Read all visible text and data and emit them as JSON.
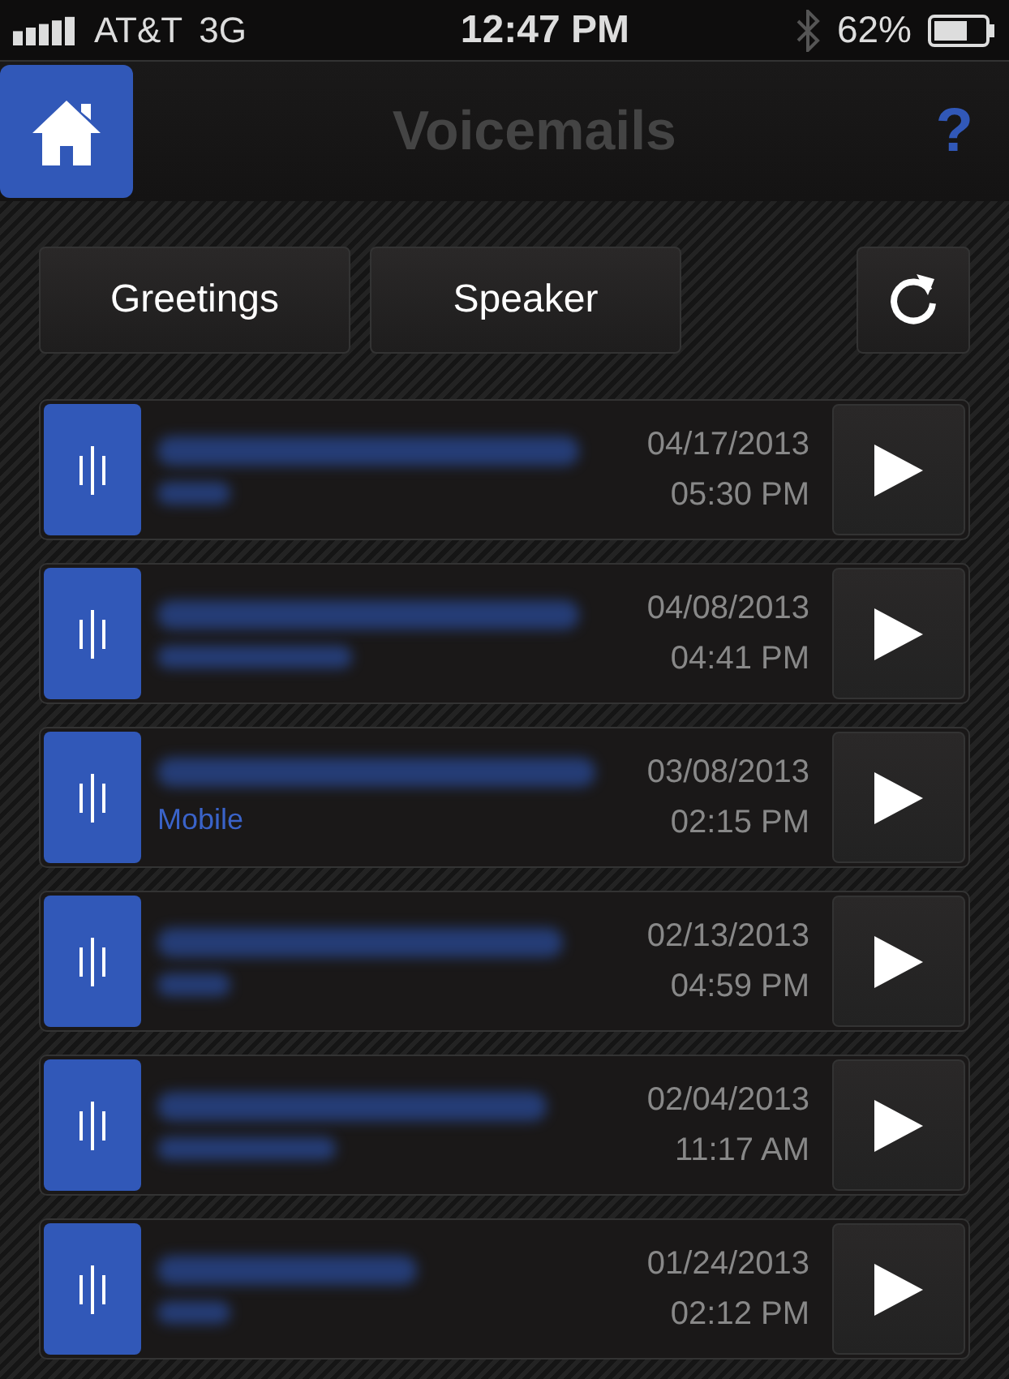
{
  "status_bar": {
    "carrier": "AT&T",
    "network": "3G",
    "time": "12:47 PM",
    "battery": "62%"
  },
  "header": {
    "title": "Voicemails",
    "help": "?"
  },
  "actions": [
    "Greetings",
    "Speaker"
  ],
  "voicemails": [
    {
      "date": "04/17/2013",
      "time": "05:30 PM"
    },
    {
      "date": "04/08/2013",
      "time": "04:41 PM"
    },
    {
      "date": "03/08/2013",
      "time": "02:15 PM",
      "label": "Mobile"
    },
    {
      "date": "02/13/2013",
      "time": "04:59 PM"
    },
    {
      "date": "02/04/2013",
      "time": "11:17 AM"
    },
    {
      "date": "01/24/2013",
      "time": "02:12 PM"
    }
  ]
}
